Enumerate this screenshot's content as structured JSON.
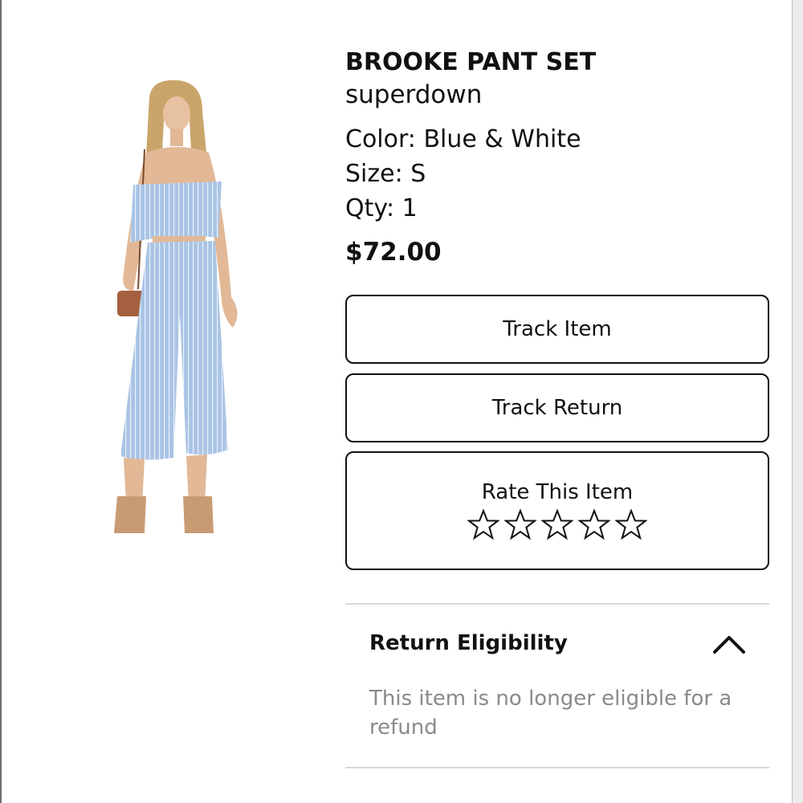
{
  "product": {
    "title": "BROOKE PANT SET",
    "brand": "superdown",
    "color_line": "Color: Blue & White",
    "size_line": "Size: S",
    "qty_line": "Qty: 1",
    "price": "$72.00",
    "image_alt": "Model wearing blue and white striped strapless ruffle crop top and wide-leg cropped pants"
  },
  "actions": {
    "track_item_label": "Track Item",
    "track_return_label": "Track Return"
  },
  "rating": {
    "label": "Rate This Item",
    "max_stars": 5,
    "value": 0,
    "star_icon": "star-outline-icon"
  },
  "return_eligibility": {
    "title": "Return Eligibility",
    "expanded": true,
    "toggle_icon": "chevron-up-icon",
    "message": "This item is no longer eligible for a refund"
  },
  "colors": {
    "text": "#111111",
    "muted_text": "#8a8a8a",
    "border": "#111111",
    "divider": "#d9d9d9"
  }
}
